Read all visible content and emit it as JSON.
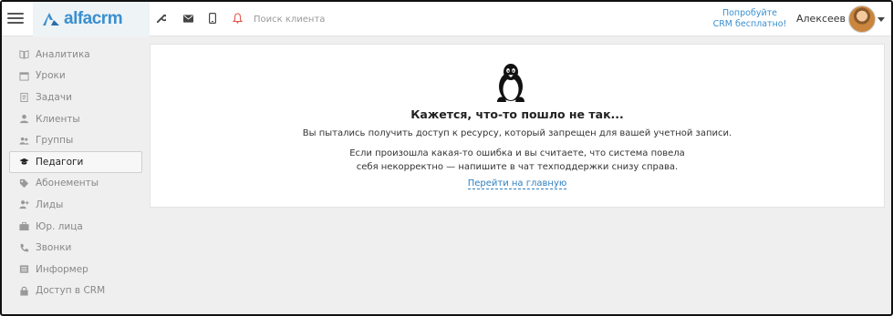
{
  "header": {
    "logo_text": "alfacrm",
    "search_placeholder": "Поиск клиента",
    "promo_line1": "Попробуйте",
    "promo_line2": "CRM бесплатно!",
    "username": "Алексеев"
  },
  "icons": {
    "menu": "hamburger-icon",
    "tools": [
      "wrench-icon",
      "envelope-icon",
      "phone-icon",
      "bell-icon"
    ],
    "bell_color": "#e05a4f",
    "accent": "#3a8fcf"
  },
  "sidebar": {
    "items": [
      {
        "label": "Аналитика",
        "icon": "book-icon"
      },
      {
        "label": "Уроки",
        "icon": "calendar-icon"
      },
      {
        "label": "Задачи",
        "icon": "clipboard-icon"
      },
      {
        "label": "Клиенты",
        "icon": "user-icon"
      },
      {
        "label": "Группы",
        "icon": "users-icon"
      },
      {
        "label": "Педагоги",
        "icon": "graduation-cap-icon",
        "active": true
      },
      {
        "label": "Абонементы",
        "icon": "tag-icon"
      },
      {
        "label": "Лиды",
        "icon": "user-plus-icon"
      },
      {
        "label": "Юр. лица",
        "icon": "briefcase-icon"
      },
      {
        "label": "Звонки",
        "icon": "phone-call-icon"
      },
      {
        "label": "Информер",
        "icon": "list-icon"
      },
      {
        "label": "Доступ в CRM",
        "icon": "lock-icon"
      }
    ]
  },
  "error": {
    "title": "Кажется, что-то пошло не так...",
    "text1": "Вы пытались получить доступ к ресурсу, который запрещен для вашей учетной записи.",
    "text2_line1": "Если произошла какая-то ошибка и вы считаете, что система повела",
    "text2_line2": "себя некорректно — напишите в чат техподдержки снизу справа.",
    "home_link": "Перейти на главную"
  }
}
